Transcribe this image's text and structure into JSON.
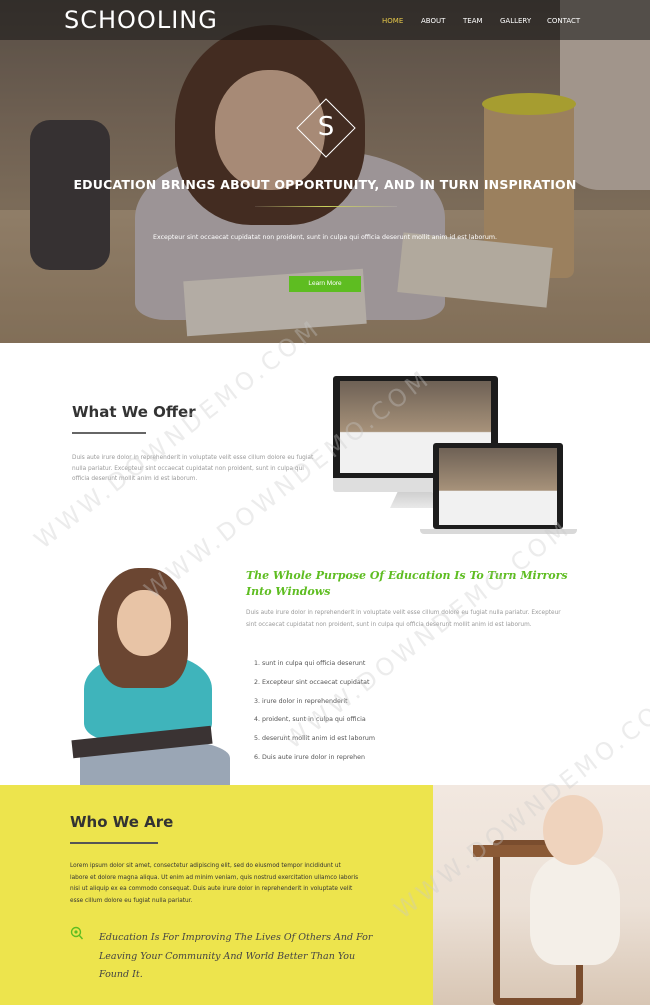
{
  "header": {
    "logo": "SCHOOLING",
    "nav": [
      {
        "label": "HOME",
        "active": true
      },
      {
        "label": "ABOUT",
        "active": false
      },
      {
        "label": "TEAM",
        "active": false
      },
      {
        "label": "GALLERY",
        "active": false
      },
      {
        "label": "CONTACT",
        "active": false
      }
    ]
  },
  "hero": {
    "badge_letter": "S",
    "title": "EDUCATION BRINGS ABOUT OPPORTUNITY, AND IN TURN INSPIRATION",
    "subtitle": "Excepteur sint occaecat cupidatat non proident, sunt in culpa qui officia deserunt mollit anim id est laborum.",
    "button_label": "Learn More"
  },
  "offer": {
    "title": "What We Offer",
    "text": "Duis aute irure dolor in reprehenderit in voluptate velit esse cillum dolore eu fugiat nulla pariatur. Excepteur sint occaecat cupidatat non proident, sunt in culpa qui officia deserunt mollit anim id est laborum."
  },
  "purpose": {
    "title": "The Whole Purpose Of Education Is To Turn Mirrors Into Windows",
    "text": "Duis aute irure dolor in reprehenderit in voluptate velit esse cillum dolore eu fugiat nulla pariatur. Excepteur sint occaecat cupidatat non proident, sunt in culpa qui officia deserunt mollit anim id est laborum.",
    "list": [
      "1.  sunt in culpa qui officia deserunt",
      "2.  Excepteur sint occaecat cupidatat",
      "3.  irure dolor in reprehenderit",
      "4.  proident, sunt in culpa qui officia",
      "5.  deserunt mollit anim id est laborum",
      "6.  Duis aute irure dolor in reprehen"
    ]
  },
  "who": {
    "title": "Who We Are",
    "text": "Lorem ipsum dolor sit amet, consectetur adipiscing elit, sed do eiusmod tempor incididunt ut labore et dolore magna aliqua. Ut enim ad minim veniam, quis nostrud exercitation ullamco laboris nisi ut aliquip ex ea commodo consequat. Duis aute irure dolor in reprehenderit in voluptate velit esse cillum dolore eu fugiat nulla pariatur.",
    "quote": "Education Is For Improving The Lives Of Others And For Leaving Your Community And World Better Than You Found It."
  },
  "watermark": "WWW.DOWNDEMO.COM",
  "colors": {
    "accent_green": "#5ebd21",
    "nav_active": "#e6c84a",
    "who_bg": "#ede44d"
  },
  "icons": {
    "quote": "graduation-badge-icon"
  }
}
